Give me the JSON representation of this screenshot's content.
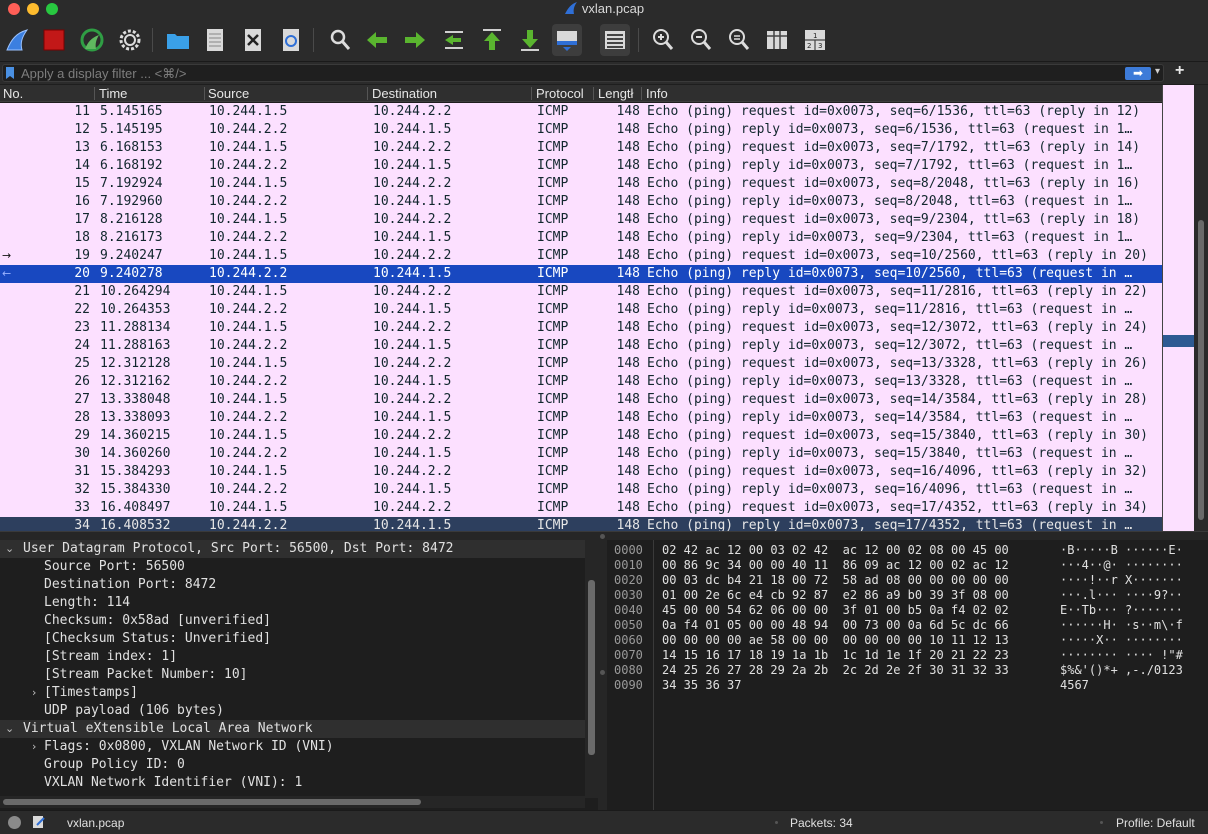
{
  "window": {
    "title": "vxlan.pcap"
  },
  "toolbar": {
    "buttons": [
      "start-capture",
      "stop-capture",
      "restart-capture",
      "capture-options",
      "open-file",
      "save-file",
      "close-file",
      "reload-file",
      "find-packet",
      "go-back",
      "go-forward",
      "go-to-packet",
      "go-first",
      "go-last",
      "auto-scroll",
      "colorize",
      "zoom-in",
      "zoom-out",
      "zoom-reset",
      "resize-columns",
      "layout"
    ]
  },
  "filter": {
    "placeholder": "Apply a display filter ... <⌘/>",
    "apply_symbol": "➡",
    "dropdown_symbol": "▾",
    "add_symbol": "+"
  },
  "packet_list": {
    "columns": {
      "no": "No.",
      "time": "Time",
      "source": "Source",
      "destination": "Destination",
      "protocol": "Protocol",
      "length": "Lengtł",
      "info": "Info"
    },
    "rows": [
      {
        "no": "11",
        "time": "5.145165",
        "src": "10.244.1.5",
        "dst": "10.244.2.2",
        "proto": "ICMP",
        "len": "148",
        "info": "Echo (ping) request  id=0x0073, seq=6/1536, ttl=63 (reply in 12)",
        "mark": ""
      },
      {
        "no": "12",
        "time": "5.145195",
        "src": "10.244.2.2",
        "dst": "10.244.1.5",
        "proto": "ICMP",
        "len": "148",
        "info": "Echo (ping) reply    id=0x0073, seq=6/1536, ttl=63 (request in 1…",
        "mark": ""
      },
      {
        "no": "13",
        "time": "6.168153",
        "src": "10.244.1.5",
        "dst": "10.244.2.2",
        "proto": "ICMP",
        "len": "148",
        "info": "Echo (ping) request  id=0x0073, seq=7/1792, ttl=63 (reply in 14)",
        "mark": ""
      },
      {
        "no": "14",
        "time": "6.168192",
        "src": "10.244.2.2",
        "dst": "10.244.1.5",
        "proto": "ICMP",
        "len": "148",
        "info": "Echo (ping) reply    id=0x0073, seq=7/1792, ttl=63 (request in 1…",
        "mark": ""
      },
      {
        "no": "15",
        "time": "7.192924",
        "src": "10.244.1.5",
        "dst": "10.244.2.2",
        "proto": "ICMP",
        "len": "148",
        "info": "Echo (ping) request  id=0x0073, seq=8/2048, ttl=63 (reply in 16)",
        "mark": ""
      },
      {
        "no": "16",
        "time": "7.192960",
        "src": "10.244.2.2",
        "dst": "10.244.1.5",
        "proto": "ICMP",
        "len": "148",
        "info": "Echo (ping) reply    id=0x0073, seq=8/2048, ttl=63 (request in 1…",
        "mark": ""
      },
      {
        "no": "17",
        "time": "8.216128",
        "src": "10.244.1.5",
        "dst": "10.244.2.2",
        "proto": "ICMP",
        "len": "148",
        "info": "Echo (ping) request  id=0x0073, seq=9/2304, ttl=63 (reply in 18)",
        "mark": ""
      },
      {
        "no": "18",
        "time": "8.216173",
        "src": "10.244.2.2",
        "dst": "10.244.1.5",
        "proto": "ICMP",
        "len": "148",
        "info": "Echo (ping) reply    id=0x0073, seq=9/2304, ttl=63 (request in 1…",
        "mark": ""
      },
      {
        "no": "19",
        "time": "9.240247",
        "src": "10.244.1.5",
        "dst": "10.244.2.2",
        "proto": "ICMP",
        "len": "148",
        "info": "Echo (ping) request  id=0x0073, seq=10/2560, ttl=63 (reply in 20)",
        "mark": "→"
      },
      {
        "no": "20",
        "time": "9.240278",
        "src": "10.244.2.2",
        "dst": "10.244.1.5",
        "proto": "ICMP",
        "len": "148",
        "info": "Echo (ping) reply    id=0x0073, seq=10/2560, ttl=63 (request in …",
        "mark": "←"
      },
      {
        "no": "21",
        "time": "10.264294",
        "src": "10.244.1.5",
        "dst": "10.244.2.2",
        "proto": "ICMP",
        "len": "148",
        "info": "Echo (ping) request  id=0x0073, seq=11/2816, ttl=63 (reply in 22)",
        "mark": ""
      },
      {
        "no": "22",
        "time": "10.264353",
        "src": "10.244.2.2",
        "dst": "10.244.1.5",
        "proto": "ICMP",
        "len": "148",
        "info": "Echo (ping) reply    id=0x0073, seq=11/2816, ttl=63 (request in …",
        "mark": ""
      },
      {
        "no": "23",
        "time": "11.288134",
        "src": "10.244.1.5",
        "dst": "10.244.2.2",
        "proto": "ICMP",
        "len": "148",
        "info": "Echo (ping) request  id=0x0073, seq=12/3072, ttl=63 (reply in 24)",
        "mark": ""
      },
      {
        "no": "24",
        "time": "11.288163",
        "src": "10.244.2.2",
        "dst": "10.244.1.5",
        "proto": "ICMP",
        "len": "148",
        "info": "Echo (ping) reply    id=0x0073, seq=12/3072, ttl=63 (request in …",
        "mark": ""
      },
      {
        "no": "25",
        "time": "12.312128",
        "src": "10.244.1.5",
        "dst": "10.244.2.2",
        "proto": "ICMP",
        "len": "148",
        "info": "Echo (ping) request  id=0x0073, seq=13/3328, ttl=63 (reply in 26)",
        "mark": ""
      },
      {
        "no": "26",
        "time": "12.312162",
        "src": "10.244.2.2",
        "dst": "10.244.1.5",
        "proto": "ICMP",
        "len": "148",
        "info": "Echo (ping) reply    id=0x0073, seq=13/3328, ttl=63 (request in …",
        "mark": ""
      },
      {
        "no": "27",
        "time": "13.338048",
        "src": "10.244.1.5",
        "dst": "10.244.2.2",
        "proto": "ICMP",
        "len": "148",
        "info": "Echo (ping) request  id=0x0073, seq=14/3584, ttl=63 (reply in 28)",
        "mark": ""
      },
      {
        "no": "28",
        "time": "13.338093",
        "src": "10.244.2.2",
        "dst": "10.244.1.5",
        "proto": "ICMP",
        "len": "148",
        "info": "Echo (ping) reply    id=0x0073, seq=14/3584, ttl=63 (request in …",
        "mark": ""
      },
      {
        "no": "29",
        "time": "14.360215",
        "src": "10.244.1.5",
        "dst": "10.244.2.2",
        "proto": "ICMP",
        "len": "148",
        "info": "Echo (ping) request  id=0x0073, seq=15/3840, ttl=63 (reply in 30)",
        "mark": ""
      },
      {
        "no": "30",
        "time": "14.360260",
        "src": "10.244.2.2",
        "dst": "10.244.1.5",
        "proto": "ICMP",
        "len": "148",
        "info": "Echo (ping) reply    id=0x0073, seq=15/3840, ttl=63 (request in …",
        "mark": ""
      },
      {
        "no": "31",
        "time": "15.384293",
        "src": "10.244.1.5",
        "dst": "10.244.2.2",
        "proto": "ICMP",
        "len": "148",
        "info": "Echo (ping) request  id=0x0073, seq=16/4096, ttl=63 (reply in 32)",
        "mark": ""
      },
      {
        "no": "32",
        "time": "15.384330",
        "src": "10.244.2.2",
        "dst": "10.244.1.5",
        "proto": "ICMP",
        "len": "148",
        "info": "Echo (ping) reply    id=0x0073, seq=16/4096, ttl=63 (request in …",
        "mark": ""
      },
      {
        "no": "33",
        "time": "16.408497",
        "src": "10.244.1.5",
        "dst": "10.244.2.2",
        "proto": "ICMP",
        "len": "148",
        "info": "Echo (ping) request  id=0x0073, seq=17/4352, ttl=63 (reply in 34)",
        "mark": ""
      },
      {
        "no": "34",
        "time": "16.408532",
        "src": "10.244.2.2",
        "dst": "10.244.1.5",
        "proto": "ICMP",
        "len": "148",
        "info": "Echo (ping) reply    id=0x0073, seq=17/4352, ttl=63 (request in …",
        "mark": ""
      }
    ],
    "selected_no": "20",
    "last_no": "34"
  },
  "details": {
    "rows": [
      {
        "text": "User Datagram Protocol, Src Port: 56500, Dst Port: 8472",
        "arrow": "⌄",
        "level": 0,
        "section": true
      },
      {
        "text": "Source Port: 56500",
        "arrow": "",
        "level": 1,
        "section": false
      },
      {
        "text": "Destination Port: 8472",
        "arrow": "",
        "level": 1,
        "section": false
      },
      {
        "text": "Length: 114",
        "arrow": "",
        "level": 1,
        "section": false
      },
      {
        "text": "Checksum: 0x58ad [unverified]",
        "arrow": "",
        "level": 1,
        "section": false
      },
      {
        "text": "[Checksum Status: Unverified]",
        "arrow": "",
        "level": 1,
        "section": false
      },
      {
        "text": "[Stream index: 1]",
        "arrow": "",
        "level": 1,
        "section": false
      },
      {
        "text": "[Stream Packet Number: 10]",
        "arrow": "",
        "level": 1,
        "section": false
      },
      {
        "text": "[Timestamps]",
        "arrow": "›",
        "level": 1,
        "section": false
      },
      {
        "text": "UDP payload (106 bytes)",
        "arrow": "",
        "level": 1,
        "section": false
      },
      {
        "text": "Virtual eXtensible Local Area Network",
        "arrow": "⌄",
        "level": 0,
        "section": true
      },
      {
        "text": "Flags: 0x0800, VXLAN Network ID (VNI)",
        "arrow": "›",
        "level": 1,
        "section": false
      },
      {
        "text": "Group Policy ID: 0",
        "arrow": "",
        "level": 1,
        "section": false
      },
      {
        "text": "VXLAN Network Identifier (VNI): 1",
        "arrow": "",
        "level": 1,
        "section": false
      }
    ]
  },
  "bytes": {
    "rows": [
      {
        "off": "0000",
        "hex": "02 42 ac 12 00 03 02 42  ac 12 00 02 08 00 45 00",
        "ascii": "·B·····B ······E·"
      },
      {
        "off": "0010",
        "hex": "00 86 9c 34 00 00 40 11  86 09 ac 12 00 02 ac 12",
        "ascii": "···4··@· ········"
      },
      {
        "off": "0020",
        "hex": "00 03 dc b4 21 18 00 72  58 ad 08 00 00 00 00 00",
        "ascii": "····!··r X·······"
      },
      {
        "off": "0030",
        "hex": "01 00 2e 6c e4 cb 92 87  e2 86 a9 b0 39 3f 08 00",
        "ascii": "···.l··· ····9?··"
      },
      {
        "off": "0040",
        "hex": "45 00 00 54 62 06 00 00  3f 01 00 b5 0a f4 02 02",
        "ascii": "E··Tb··· ?·······"
      },
      {
        "off": "0050",
        "hex": "0a f4 01 05 00 00 48 94  00 73 00 0a 6d 5c dc 66",
        "ascii": "······H· ·s··m\\·f"
      },
      {
        "off": "0060",
        "hex": "00 00 00 00 ae 58 00 00  00 00 00 00 10 11 12 13",
        "ascii": "·····X·· ········"
      },
      {
        "off": "0070",
        "hex": "14 15 16 17 18 19 1a 1b  1c 1d 1e 1f 20 21 22 23",
        "ascii": "········ ···· !\"#"
      },
      {
        "off": "0080",
        "hex": "24 25 26 27 28 29 2a 2b  2c 2d 2e 2f 30 31 32 33",
        "ascii": "$%&'()*+ ,-./0123"
      },
      {
        "off": "0090",
        "hex": "34 35 36 37",
        "ascii": "4567"
      }
    ]
  },
  "status": {
    "file": "vxlan.pcap",
    "packets": "Packets: 34",
    "profile": "Profile: Default"
  },
  "colors": {
    "row_bg": "#fce0ff",
    "selected_bg": "#1848c0",
    "last_bg": "#2d3f5e",
    "accent": "#3d7bd8"
  }
}
